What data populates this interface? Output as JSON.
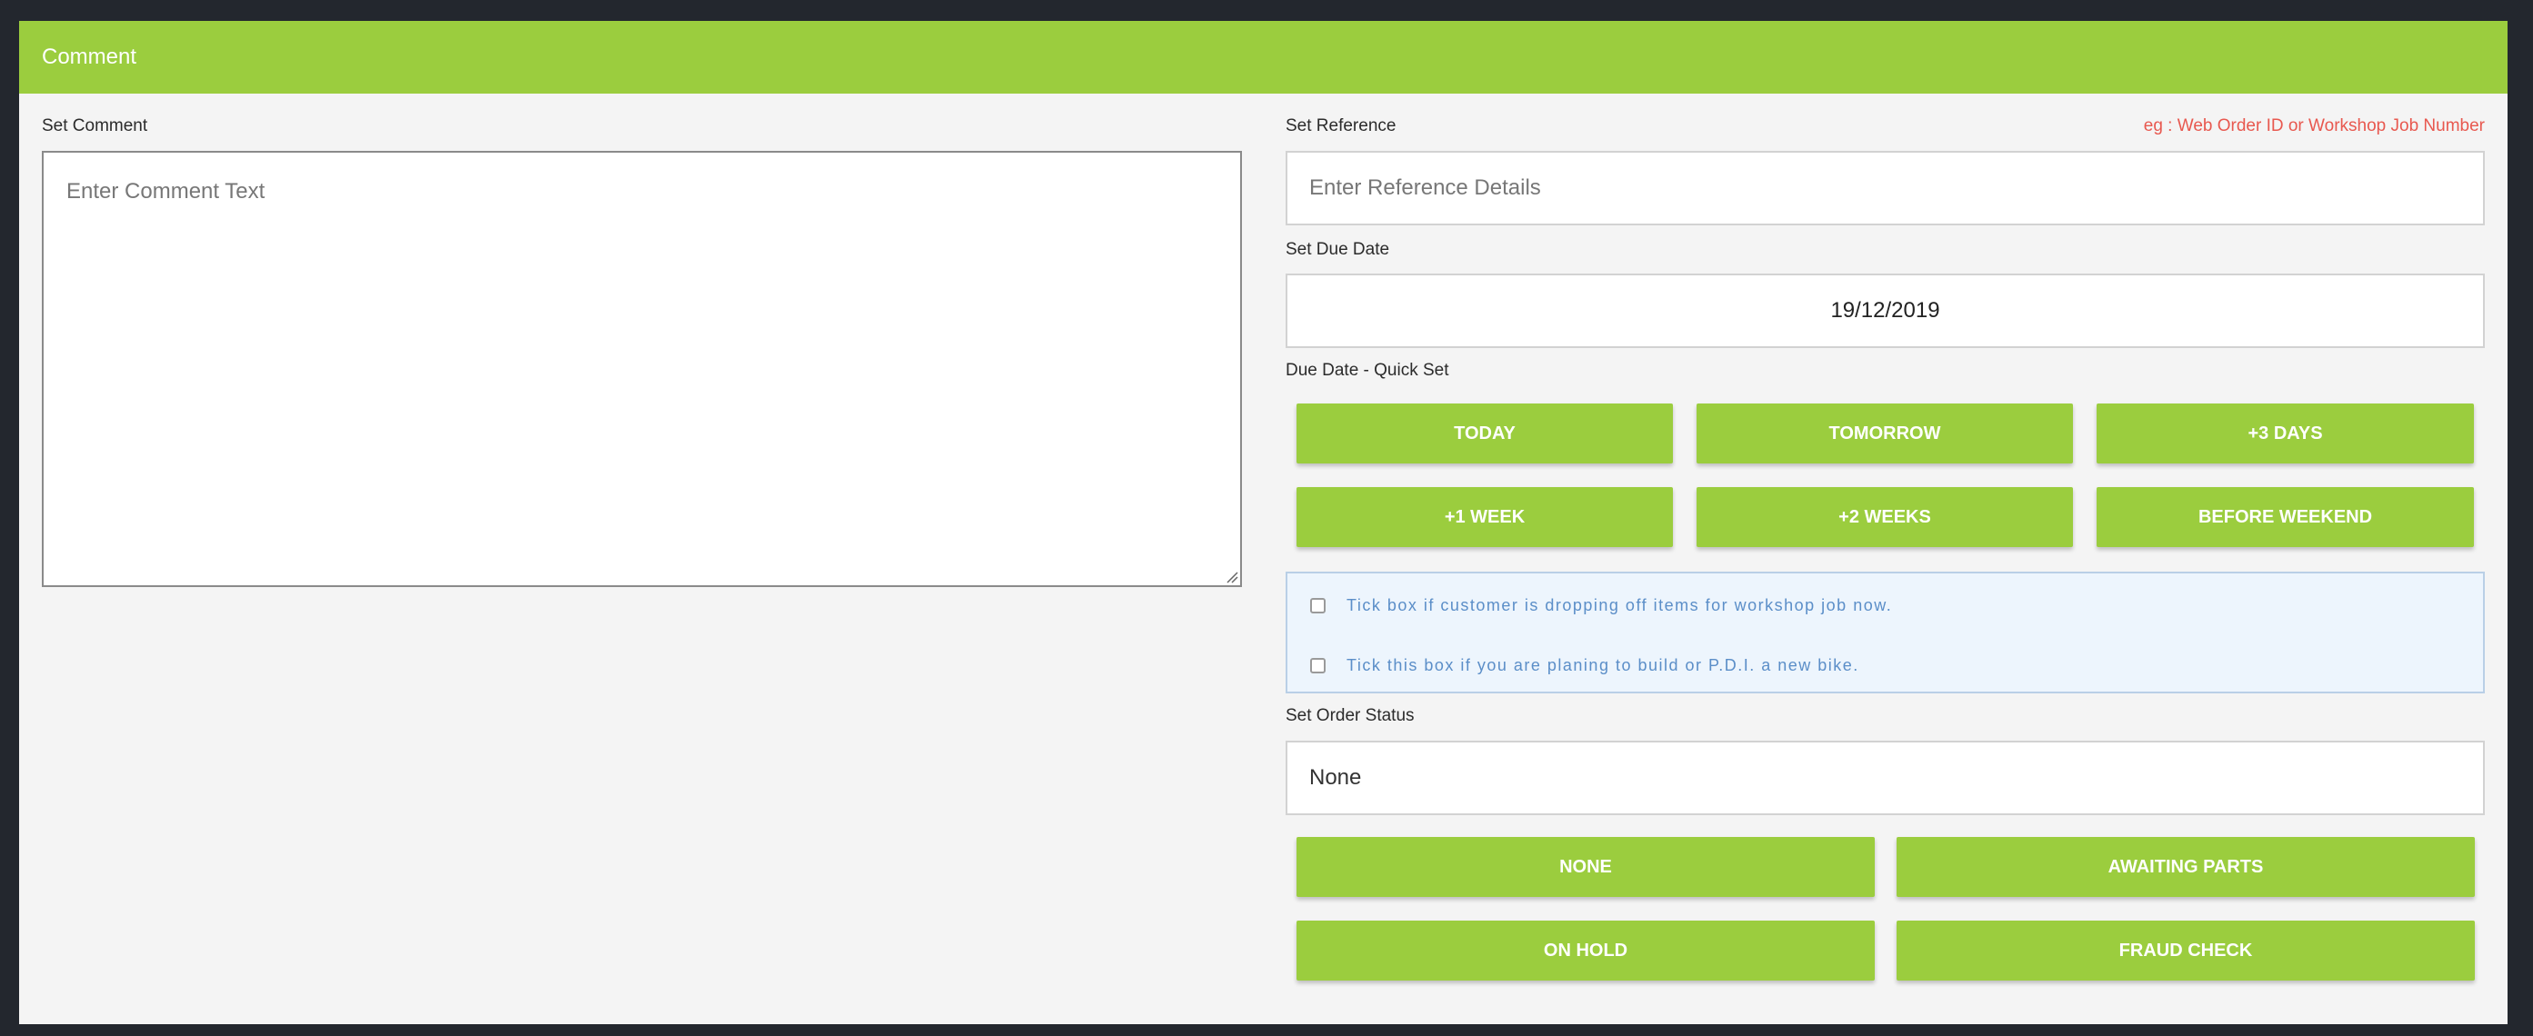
{
  "header": {
    "title": "Comment"
  },
  "comment": {
    "label": "Set Comment",
    "placeholder": "Enter Comment Text"
  },
  "reference": {
    "label": "Set Reference",
    "hint": "eg : Web Order ID or Workshop Job Number",
    "placeholder": "Enter Reference Details"
  },
  "due_date": {
    "label": "Set Due Date",
    "value": "19/12/2019"
  },
  "quick_set": {
    "label": "Due Date - Quick Set",
    "buttons": [
      "TODAY",
      "TOMORROW",
      "+3 DAYS",
      "+1 WEEK",
      "+2 WEEKS",
      "BEFORE WEEKEND"
    ]
  },
  "checkboxes": [
    {
      "label": "Tick box if customer is dropping off items for workshop job now.",
      "checked": false
    },
    {
      "label": "Tick this box if you are planing to build or P.D.I. a new bike.",
      "checked": false
    }
  ],
  "order_status": {
    "label": "Set Order Status",
    "value": "None",
    "buttons": [
      "NONE",
      "AWAITING PARTS",
      "ON HOLD",
      "FRAUD CHECK"
    ]
  },
  "colors": {
    "accent": "#9bcd3e",
    "hint": "#e8584f",
    "info_text": "#5b8ec8",
    "info_bg": "#edf5fd"
  }
}
